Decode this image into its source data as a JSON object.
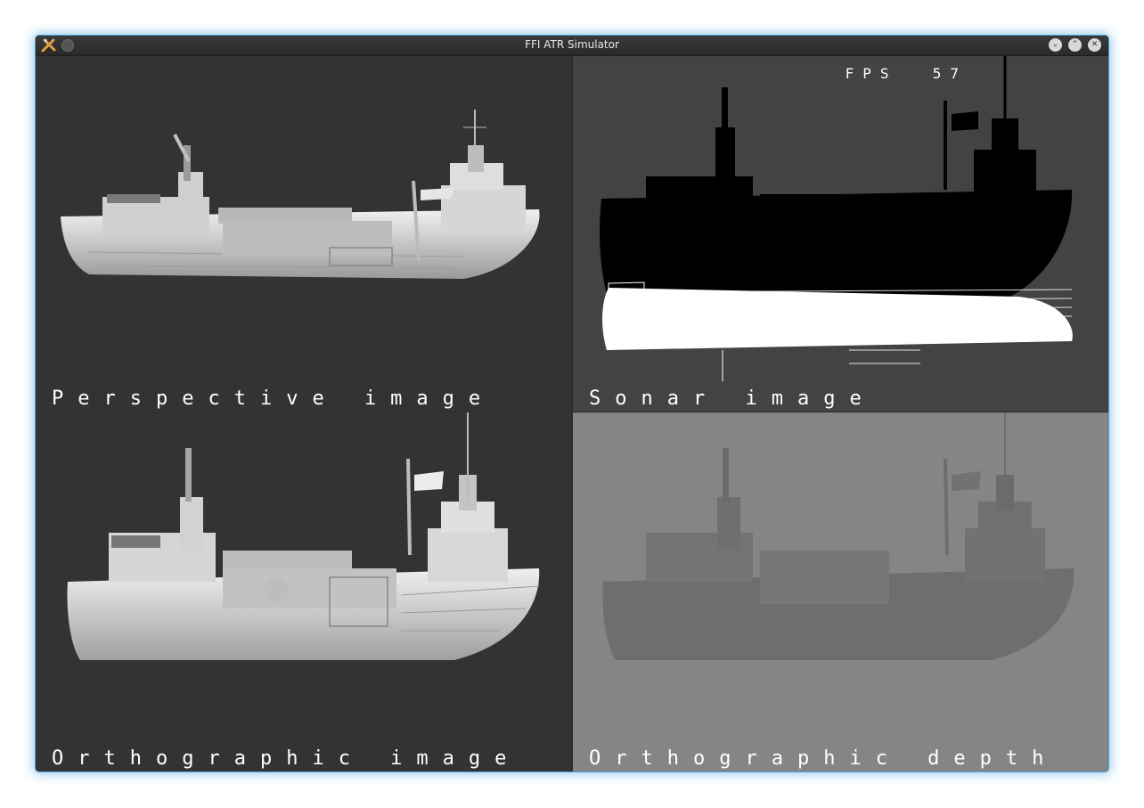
{
  "window": {
    "title": "FFI ATR Simulator",
    "app_icon": "tools-icon",
    "controls": {
      "minimize": "⌄",
      "maximize": "⌃",
      "close": "✕"
    }
  },
  "panes": {
    "perspective": {
      "label": "Perspective image"
    },
    "sonar": {
      "label": "Sonar image",
      "fps_label": "FPS",
      "fps_value": "57"
    },
    "ortho_image": {
      "label": "Orthographic image"
    },
    "ortho_depth": {
      "label": "Orthographic depth"
    }
  },
  "colors": {
    "viewport_bg": "#333333",
    "depth_bg": "#858585",
    "ship_hull": "#d8d8d8",
    "sonar_shadow": "#000000",
    "accent_glow": "#4aa3d8"
  }
}
